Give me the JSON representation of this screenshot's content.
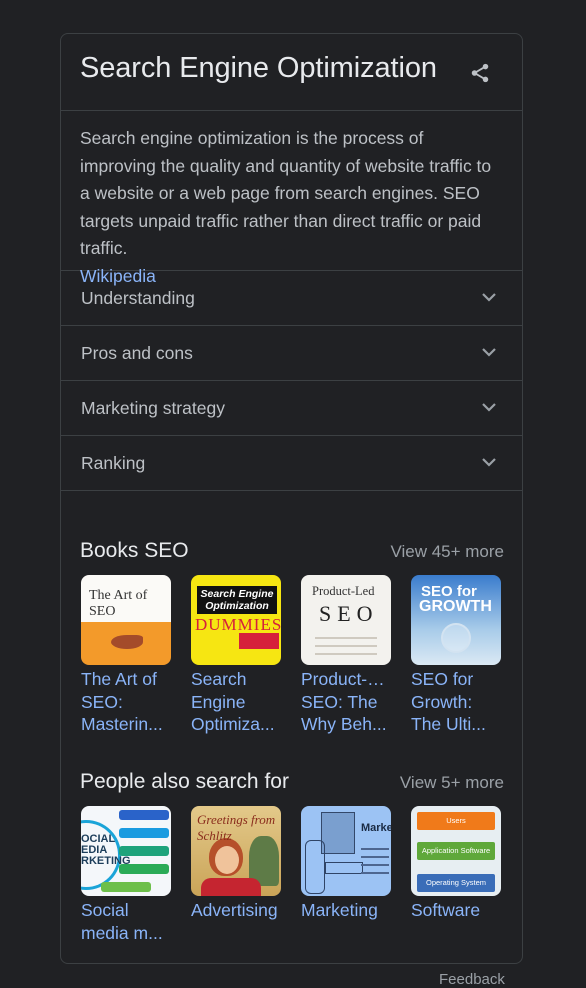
{
  "colors": {
    "background": "#202124",
    "border": "#3c4043",
    "title_text": "#e8eaed",
    "body_text": "#bdc1c6",
    "link": "#8ab4f8",
    "muted": "#9aa0a6"
  },
  "panel": {
    "title": "Search Engine Optimization",
    "share_icon": "share-icon",
    "description": "Search engine optimization is the process of improving the quality and quantity of website traffic to a website or a web page from search engines. SEO targets unpaid traffic rather than direct traffic or paid traffic.",
    "source_link": "Wikipedia"
  },
  "accordion": [
    {
      "label": "Understanding",
      "icon": "chevron-down-icon"
    },
    {
      "label": "Pros and cons",
      "icon": "chevron-down-icon"
    },
    {
      "label": "Marketing strategy",
      "icon": "chevron-down-icon"
    },
    {
      "label": "Ranking",
      "icon": "chevron-down-icon"
    }
  ],
  "books": {
    "title": "Books SEO",
    "view_more": "View 45+ more",
    "items": [
      {
        "label": "The Art of SEO: Masterin...",
        "line1": "The Art of",
        "line2": "SEO:",
        "line3": "Masterin...",
        "cover_text": "The Art of SEO"
      },
      {
        "label": "Search Engine Optimiza...",
        "line1": "Search",
        "line2": "Engine",
        "line3": "Optimiza...",
        "cover_text": "Search Engine Optimization",
        "cover_text2": "DUMMIES"
      },
      {
        "label": "Product-... SEO: The Why Beh...",
        "line1": "Product-…",
        "line2": "SEO: The",
        "line3": "Why Beh...",
        "cover_text": "Product-Led",
        "cover_text2": "SEO"
      },
      {
        "label": "SEO for Growth: The Ulti...",
        "line1": "SEO for",
        "line2": "Growth:",
        "line3": "The Ulti...",
        "cover_text": "SEO for",
        "cover_text2": "GROWTH"
      }
    ]
  },
  "people_also_search": {
    "title": "People also search for",
    "view_more": "View 5+ more",
    "items": [
      {
        "label": "Social media m...",
        "line1": "Social",
        "line2": "media m...",
        "thumb_text": "OCIAL EDIA RKETING"
      },
      {
        "label": "Advertising",
        "line1": "Advertising",
        "thumb_text": "Greetings from Schlitz"
      },
      {
        "label": "Marketing",
        "line1": "Marketing",
        "thumb_text": "Marketi"
      },
      {
        "label": "Software",
        "line1": "Software",
        "thumb_text": [
          "Users",
          "Application Software",
          "Operating System"
        ]
      }
    ]
  },
  "footer": {
    "feedback": "Feedback"
  }
}
